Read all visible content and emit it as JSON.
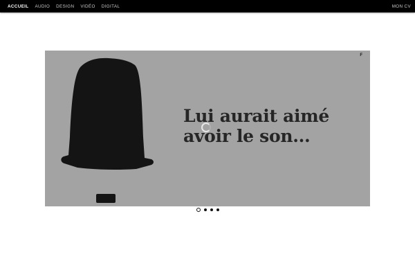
{
  "nav": {
    "items": [
      {
        "label": "ACCUEIL",
        "active": true
      },
      {
        "label": "AUDIO",
        "active": false
      },
      {
        "label": "DESIGN",
        "active": false
      },
      {
        "label": "VIDÉO",
        "active": false
      },
      {
        "label": "DIGITAL",
        "active": false
      }
    ],
    "cv_label": "MON CV"
  },
  "slide": {
    "headline_line1": "Lui aurait aimé",
    "headline_line2": "avoir le son...",
    "corner_mark": "F",
    "image_icon": "bowler-hat-icon",
    "background_color": "#a3a3a3"
  },
  "pagination": {
    "count": 4,
    "active_index": 0
  },
  "colors": {
    "topbar": "#000000",
    "nav_active": "#ffffff",
    "nav_inactive": "#c9c9c9",
    "headline": "#262626"
  }
}
